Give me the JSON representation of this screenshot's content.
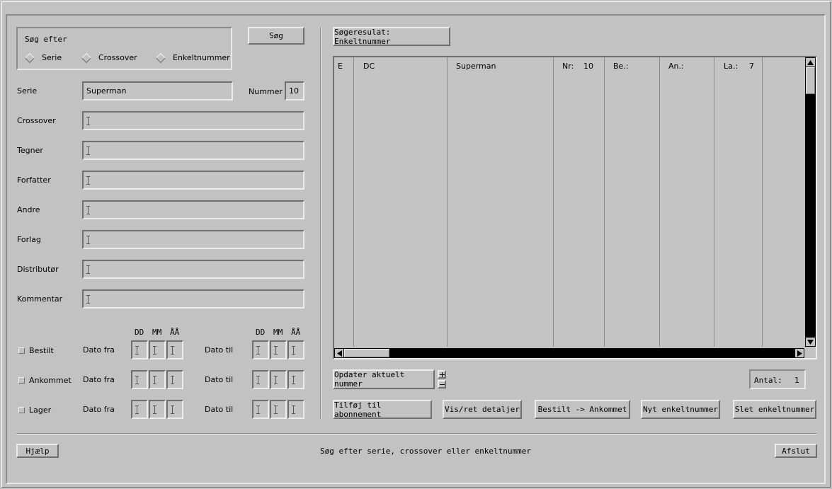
{
  "search": {
    "group_label": "Søg efter",
    "options": [
      "Serie",
      "Crossover",
      "Enkeltnummer"
    ],
    "button": "Søg"
  },
  "form": {
    "serie_label": "Serie",
    "serie_value": "Superman",
    "nummer_label": "Nummer",
    "nummer_value": "10",
    "fields": [
      "Crossover",
      "Tegner",
      "Forfatter",
      "Andre",
      "Forlag",
      "Distributør",
      "Kommentar"
    ]
  },
  "dates": {
    "headers": [
      "DD",
      "MM",
      "ÅÅ"
    ],
    "rows": [
      {
        "label": "Bestilt",
        "from": "Dato fra",
        "to": "Dato til"
      },
      {
        "label": "Ankommet",
        "from": "Dato fra",
        "to": "Dato til"
      },
      {
        "label": "Lager",
        "from": "Dato fra",
        "to": "Dato til"
      }
    ]
  },
  "results": {
    "title": "Søgeresulat: Enkeltnummer",
    "row": {
      "e": "E",
      "publisher": "DC",
      "series": "Superman",
      "nr_label": "Nr:",
      "nr_value": "10",
      "be_label": "Be.:",
      "an_label": "An.:",
      "la_label": "La.:",
      "la_value": "7"
    }
  },
  "actions": {
    "update": "Opdater aktuelt nummer",
    "antal_label": "Antal:",
    "antal_value": "1",
    "add_subscription": "Tilføj til abonnement",
    "view_edit": "Vis/ret detaljer",
    "ordered_arrived": "Bestilt -> Ankommet",
    "new_issue": "Nyt enkeltnummer",
    "delete_issue": "Slet enkeltnummer"
  },
  "footer": {
    "help": "Hjælp",
    "status": "Søg efter serie, crossover eller enkeltnummer",
    "quit": "Afslut"
  }
}
